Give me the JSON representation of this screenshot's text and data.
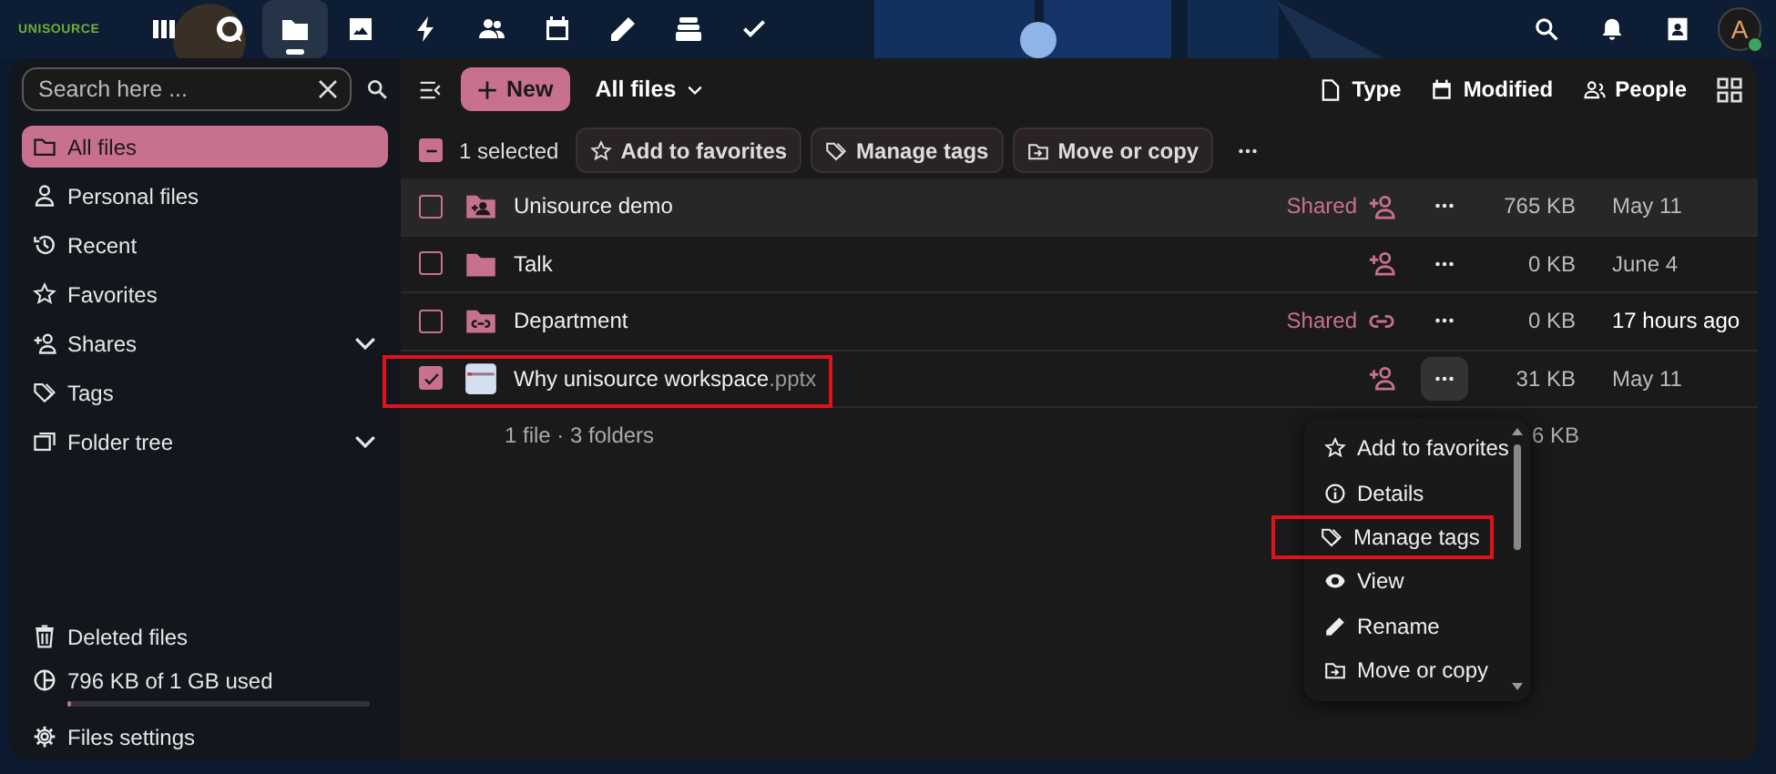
{
  "header": {
    "logo": "UNISOURCE",
    "apps": [
      {
        "selected": false
      },
      {
        "selected": false
      },
      {
        "selected": true
      },
      {
        "selected": false
      },
      {
        "selected": false
      },
      {
        "selected": false
      },
      {
        "selected": false
      },
      {
        "selected": false
      },
      {
        "selected": false
      },
      {
        "selected": false
      }
    ],
    "avatar": {
      "initial": "A",
      "online": true
    }
  },
  "sidebar": {
    "search": {
      "placeholder": "Search here ..."
    },
    "nav": [
      {
        "label": "All files",
        "selected": true,
        "expandable": false
      },
      {
        "label": "Personal files",
        "selected": false,
        "expandable": false
      },
      {
        "label": "Recent",
        "selected": false,
        "expandable": false
      },
      {
        "label": "Favorites",
        "selected": false,
        "expandable": false
      },
      {
        "label": "Shares",
        "selected": false,
        "expandable": true
      },
      {
        "label": "Tags",
        "selected": false,
        "expandable": false
      },
      {
        "label": "Folder tree",
        "selected": false,
        "expandable": true
      }
    ],
    "footer": [
      {
        "label": "Deleted files"
      },
      {
        "label": "796 KB of 1 GB used",
        "level": 0.01
      },
      {
        "label": "Files settings"
      }
    ]
  },
  "toolbar": {
    "new_button": "New",
    "breadcrumb": "All files",
    "filters": [
      "Type",
      "Modified",
      "People"
    ]
  },
  "selection_bar": {
    "indeterminate": true,
    "count": "1 selected",
    "actions": [
      "Add to favorites",
      "Manage tags",
      "Move or copy"
    ]
  },
  "files": [
    {
      "name": "Unisource demo",
      "kind": "folder-shared",
      "selected": false,
      "hovered": true,
      "shared": "Shared",
      "size": "765 KB",
      "modified": "May 11",
      "recent": false,
      "highlighted": false
    },
    {
      "name": "Talk",
      "kind": "folder",
      "selected": false,
      "hovered": false,
      "size": "0 KB",
      "modified": "June 4",
      "recent": false,
      "highlighted": false
    },
    {
      "name": "Department",
      "kind": "folder-link",
      "selected": false,
      "hovered": false,
      "shared": "Shared",
      "size": "0 KB",
      "modified": "17 hours ago",
      "recent": true,
      "highlighted": false
    },
    {
      "name": "Why unisource workspace",
      "extension": ".pptx",
      "kind": "slides",
      "selected": true,
      "hovered": false,
      "size": "31 KB",
      "modified": "May 11",
      "recent": false,
      "highlighted": true
    }
  ],
  "summary": {
    "text": "1 file · 3 folders",
    "size": "6 KB"
  },
  "context_menu": {
    "items": [
      {
        "label": "Add to favorites",
        "highlighted": false
      },
      {
        "label": "Details",
        "highlighted": false
      },
      {
        "label": "Manage tags",
        "highlighted": true
      },
      {
        "label": "View",
        "highlighted": false
      },
      {
        "label": "Rename",
        "highlighted": false
      },
      {
        "label": "Move or copy",
        "highlighted": false
      }
    ]
  }
}
